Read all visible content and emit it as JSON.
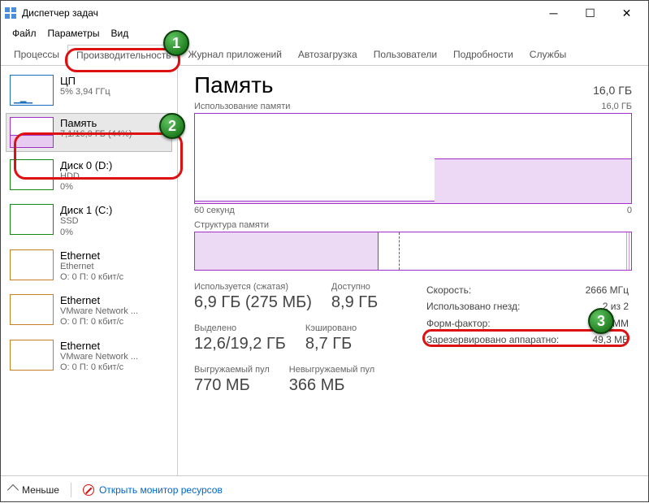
{
  "window": {
    "title": "Диспетчер задач"
  },
  "menu": {
    "file": "Файл",
    "options": "Параметры",
    "view": "Вид"
  },
  "tabs": {
    "processes": "Процессы",
    "performance": "Производительность",
    "apphistory": "Журнал приложений",
    "startup": "Автозагрузка",
    "users": "Пользователи",
    "details": "Подробности",
    "services": "Службы"
  },
  "sidebar": {
    "cpu": {
      "title": "ЦП",
      "sub": "5%  3,94 ГГц"
    },
    "mem": {
      "title": "Память",
      "sub": "7,1/16,0 ГБ (44%)"
    },
    "disk0": {
      "title": "Диск 0 (D:)",
      "sub1": "HDD",
      "sub2": "0%"
    },
    "disk1": {
      "title": "Диск 1 (C:)",
      "sub1": "SSD",
      "sub2": "0%"
    },
    "eth0": {
      "title": "Ethernet",
      "sub1": "Ethernet",
      "sub2": "О: 0  П: 0 кбит/с"
    },
    "eth1": {
      "title": "Ethernet",
      "sub1": "VMware Network ...",
      "sub2": "О: 0  П: 0 кбит/с"
    },
    "eth2": {
      "title": "Ethernet",
      "sub1": "VMware Network ...",
      "sub2": "О: 0  П: 0 кбит/с"
    }
  },
  "main": {
    "heading": "Память",
    "total": "16,0 ГБ",
    "chart1_label": "Использование памяти",
    "chart1_right": "16,0 ГБ",
    "axis_left": "60 секунд",
    "axis_right": "0",
    "chart2_label": "Структура памяти",
    "stats": {
      "used_lbl": "Используется (сжатая)",
      "used_val": "6,9 ГБ (275 МБ)",
      "avail_lbl": "Доступно",
      "avail_val": "8,9 ГБ",
      "commit_lbl": "Выделено",
      "commit_val": "12,6/19,2 ГБ",
      "cached_lbl": "Кэшировано",
      "cached_val": "8,7 ГБ",
      "paged_lbl": "Выгружаемый пул",
      "paged_val": "770 МБ",
      "nonpaged_lbl": "Невыгружаемый пул",
      "nonpaged_val": "366 МБ"
    },
    "right": {
      "speed_lbl": "Скорость:",
      "speed_val": "2666 МГц",
      "slots_lbl": "Использовано гнезд:",
      "slots_val": "2 из 2",
      "form_lbl": "Форм-фактор:",
      "form_val": "DIMM",
      "hw_lbl": "Зарезервировано аппаратно:",
      "hw_val": "49,3 МБ"
    }
  },
  "footer": {
    "less": "Меньше",
    "resmon": "Открыть монитор ресурсов"
  },
  "callouts": {
    "c1": "1",
    "c2": "2",
    "c3": "3"
  }
}
